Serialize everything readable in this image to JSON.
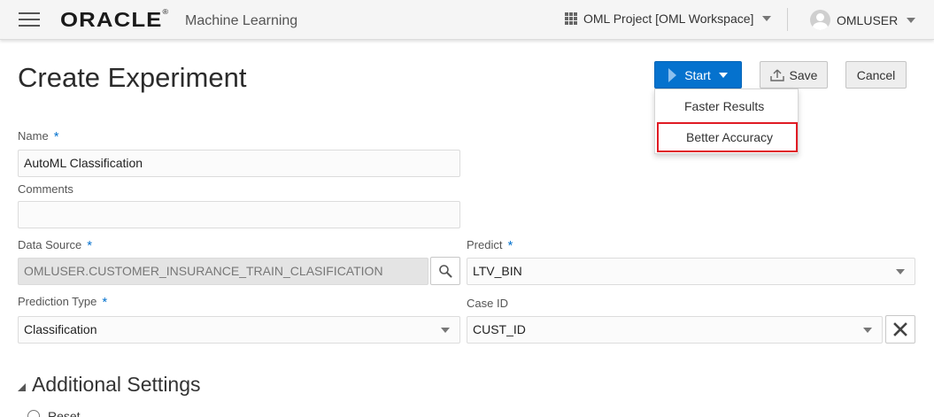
{
  "header": {
    "logo_text": "ORACLE",
    "logo_reg": "®",
    "product_name": "Machine Learning",
    "project_selector": "OML Project [OML Workspace]",
    "user_name": "OMLUSER"
  },
  "page": {
    "title": "Create Experiment"
  },
  "toolbar": {
    "start_label": "Start",
    "save_label": "Save",
    "cancel_label": "Cancel"
  },
  "start_menu": {
    "items": [
      {
        "label": "Faster Results"
      },
      {
        "label": "Better Accuracy",
        "highlighted": true
      }
    ]
  },
  "form": {
    "name": {
      "label": "Name",
      "required_mark": "*",
      "value": "AutoML Classification"
    },
    "comments": {
      "label": "Comments",
      "value": ""
    },
    "data_source": {
      "label": "Data Source",
      "required_mark": "*",
      "value": "OMLUSER.CUSTOMER_INSURANCE_TRAIN_CLASIFICATION"
    },
    "predict": {
      "label": "Predict",
      "required_mark": "*",
      "value": "LTV_BIN"
    },
    "prediction_type": {
      "label": "Prediction Type",
      "required_mark": "*",
      "value": "Classification"
    },
    "case_id": {
      "label": "Case ID",
      "value": "CUST_ID"
    }
  },
  "additional_settings": {
    "title": "Additional Settings",
    "first_option_label": "Reset"
  },
  "icons": {
    "menu": "hamburger-icon",
    "project": "grid-icon",
    "user": "avatar-icon",
    "start": "play-icon",
    "save": "upload-icon",
    "search": "search-icon",
    "clear": "close-icon",
    "section": "triangle-collapse-icon"
  },
  "colors": {
    "accent": "#0572ce",
    "highlight_border": "#e01b24"
  }
}
